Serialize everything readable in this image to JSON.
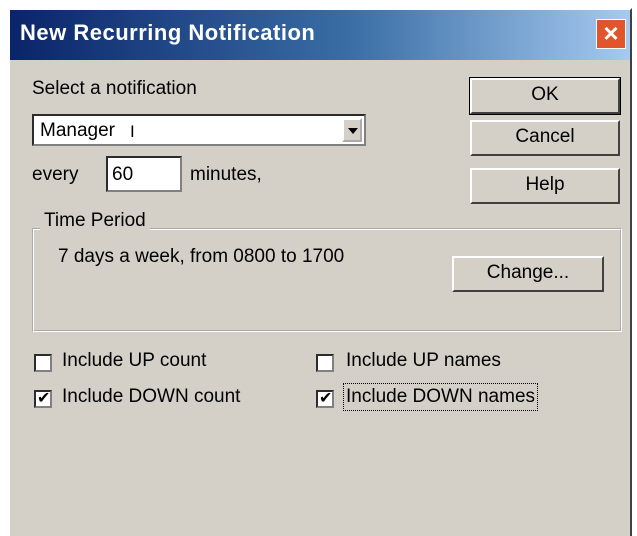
{
  "window": {
    "title": "New Recurring Notification"
  },
  "form": {
    "select_label": "Select a notification",
    "notification_value": "Manager",
    "every_label": "every",
    "minutes_value": "60",
    "minutes_suffix": "minutes,"
  },
  "buttons": {
    "ok": "OK",
    "cancel": "Cancel",
    "help": "Help",
    "change": "Change..."
  },
  "time_period": {
    "legend": "Time Period",
    "text": "7 days a week, from 0800 to 1700"
  },
  "checkboxes": {
    "up_count": {
      "label": "Include UP count",
      "checked": false
    },
    "down_count": {
      "label": "Include DOWN count",
      "checked": true
    },
    "up_names": {
      "label": "Include UP names",
      "checked": false
    },
    "down_names": {
      "label": "Include DOWN names",
      "checked": true
    }
  }
}
